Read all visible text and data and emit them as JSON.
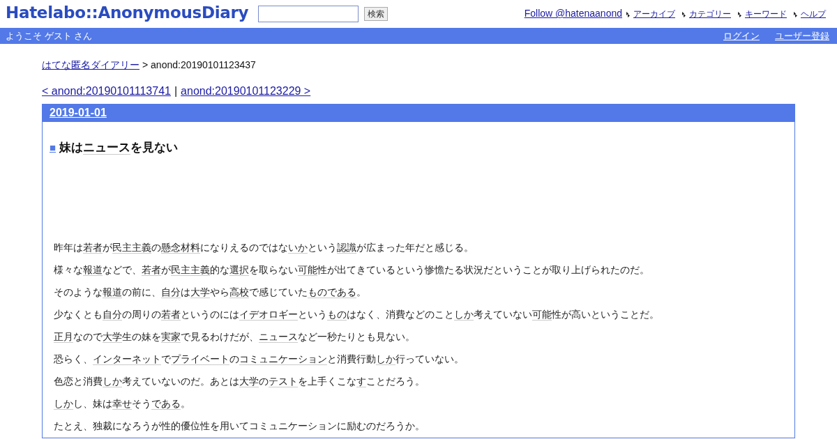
{
  "header": {
    "logo": "Hatelabo::AnonymousDiary",
    "search_button": "検索",
    "follow_link": "Follow @hatenaanond",
    "nav": [
      "アーカイブ",
      "カテゴリー",
      "キーワード",
      "ヘルプ"
    ]
  },
  "user_bar": {
    "welcome": "ようこそ ゲスト さん",
    "links": [
      "ログイン",
      "ユーザー登録"
    ]
  },
  "breadcrumb": {
    "home": "はてな匿名ダイアリー",
    "current": "> anond:20190101123437"
  },
  "pager": {
    "prev": "< anond:20190101113741",
    "separator": "|",
    "next": "anond:20190101123229 >"
  },
  "day": {
    "date": "2019-01-01",
    "title_mark": "■",
    "title": [
      {
        "text": "妹は",
        "keyword": false
      },
      {
        "text": "ニュース",
        "keyword": true
      },
      {
        "text": "を見ない",
        "keyword": false
      }
    ],
    "paragraphs": [
      {
        "parts": [
          {
            "text": "昨年は",
            "keyword": false
          },
          {
            "text": "若者",
            "keyword": true
          },
          {
            "text": "が",
            "keyword": false
          },
          {
            "text": "民主主義",
            "keyword": true
          },
          {
            "text": "の",
            "keyword": false
          },
          {
            "text": "懸念材料",
            "keyword": true
          },
          {
            "text": "になりえるのではな",
            "keyword": false
          },
          {
            "text": "いか",
            "keyword": true
          },
          {
            "text": "という",
            "keyword": false
          },
          {
            "text": "認識",
            "keyword": true
          },
          {
            "text": "が広まった年だと感じる。",
            "keyword": false
          }
        ]
      },
      {
        "parts": [
          {
            "text": "様々な",
            "keyword": false
          },
          {
            "text": "報道",
            "keyword": true
          },
          {
            "text": "などで、",
            "keyword": false
          },
          {
            "text": "若者",
            "keyword": true
          },
          {
            "text": "が",
            "keyword": false
          },
          {
            "text": "民主主義",
            "keyword": true
          },
          {
            "text": "的な",
            "keyword": false
          },
          {
            "text": "選択",
            "keyword": true
          },
          {
            "text": "を取らない",
            "keyword": false
          },
          {
            "text": "可能",
            "keyword": true
          },
          {
            "text": "性が出てきているという惨憺たる状況だということが取り上げられたのだ。",
            "keyword": false
          }
        ]
      },
      {
        "parts": [
          {
            "text": "そのような",
            "keyword": false
          },
          {
            "text": "報道",
            "keyword": true
          },
          {
            "text": "の前に、",
            "keyword": false
          },
          {
            "text": "自分",
            "keyword": true
          },
          {
            "text": "は",
            "keyword": false
          },
          {
            "text": "大学",
            "keyword": true
          },
          {
            "text": "やら",
            "keyword": false
          },
          {
            "text": "高校",
            "keyword": true
          },
          {
            "text": "で感じていた",
            "keyword": false
          },
          {
            "text": "ものである",
            "keyword": true
          },
          {
            "text": "。",
            "keyword": false
          }
        ]
      },
      {
        "parts": [
          {
            "text": "少なくとも",
            "keyword": false
          },
          {
            "text": "自分",
            "keyword": true
          },
          {
            "text": "の周りの",
            "keyword": false
          },
          {
            "text": "若者",
            "keyword": true
          },
          {
            "text": "というのには",
            "keyword": false
          },
          {
            "text": "イデオロギー",
            "keyword": true
          },
          {
            "text": "という",
            "keyword": false
          },
          {
            "text": "もの",
            "keyword": true
          },
          {
            "text": "はなく、消費などのこと",
            "keyword": false
          },
          {
            "text": "しか",
            "keyword": true
          },
          {
            "text": "考えていない",
            "keyword": false
          },
          {
            "text": "可能",
            "keyword": true
          },
          {
            "text": "性が高いということだ。",
            "keyword": false
          }
        ]
      },
      {
        "parts": [
          {
            "text": "正月",
            "keyword": true
          },
          {
            "text": "なので",
            "keyword": false
          },
          {
            "text": "大学",
            "keyword": true
          },
          {
            "text": "生の妹を",
            "keyword": false
          },
          {
            "text": "実家",
            "keyword": true
          },
          {
            "text": "で見るわけだが、",
            "keyword": false
          },
          {
            "text": "ニュース",
            "keyword": true
          },
          {
            "text": "など一秒たりとも見ない。",
            "keyword": false
          }
        ]
      },
      {
        "parts": [
          {
            "text": "恐らく、",
            "keyword": false
          },
          {
            "text": "インターネット",
            "keyword": true
          },
          {
            "text": "で",
            "keyword": false
          },
          {
            "text": "プライベート",
            "keyword": true
          },
          {
            "text": "の",
            "keyword": false
          },
          {
            "text": "コミュニケーション",
            "keyword": true
          },
          {
            "text": "と消費行動",
            "keyword": false
          },
          {
            "text": "しか",
            "keyword": true
          },
          {
            "text": "行っていない。",
            "keyword": false
          }
        ]
      },
      {
        "parts": [
          {
            "text": "色恋と消費",
            "keyword": false
          },
          {
            "text": "しか",
            "keyword": true
          },
          {
            "text": "考えていないのだ。あとは",
            "keyword": false
          },
          {
            "text": "大学",
            "keyword": true
          },
          {
            "text": "の",
            "keyword": false
          },
          {
            "text": "テスト",
            "keyword": true
          },
          {
            "text": "を上手くこな",
            "keyword": false
          },
          {
            "text": "す",
            "keyword": true
          },
          {
            "text": "ことだろう。",
            "keyword": false
          }
        ]
      },
      {
        "parts": [
          {
            "text": "しか",
            "keyword": true
          },
          {
            "text": "し、妹は",
            "keyword": false
          },
          {
            "text": "幸せ",
            "keyword": true
          },
          {
            "text": "そう",
            "keyword": false
          },
          {
            "text": "である",
            "keyword": true
          },
          {
            "text": "。",
            "keyword": false
          }
        ]
      },
      {
        "parts": [
          {
            "text": "たとえ、独裁になろうが性的優位性を用いてコミュニケーションに励むのだろうか。",
            "keyword": false
          }
        ]
      }
    ]
  }
}
